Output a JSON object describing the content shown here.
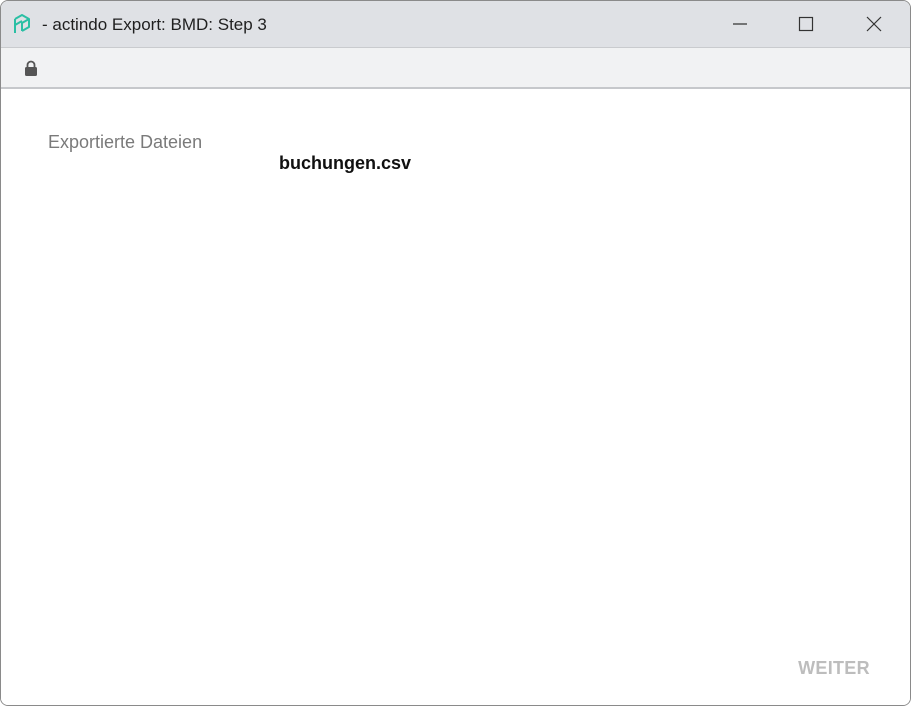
{
  "window": {
    "title": "- actindo Export: BMD: Step 3",
    "app_icon": "actindo-logo-icon",
    "controls": [
      "minimize-icon",
      "maximize-icon",
      "close-icon"
    ]
  },
  "addressbar": {
    "icon": "lock-icon"
  },
  "main": {
    "exported_files_label": "Exportierte Dateien",
    "files": [
      "buchungen.csv"
    ],
    "next_button_label": "WEITER"
  },
  "colors": {
    "accent": "#2bbfa4",
    "titlebar_bg": "#dfe1e5",
    "disabled_text": "#bdbdbd"
  }
}
